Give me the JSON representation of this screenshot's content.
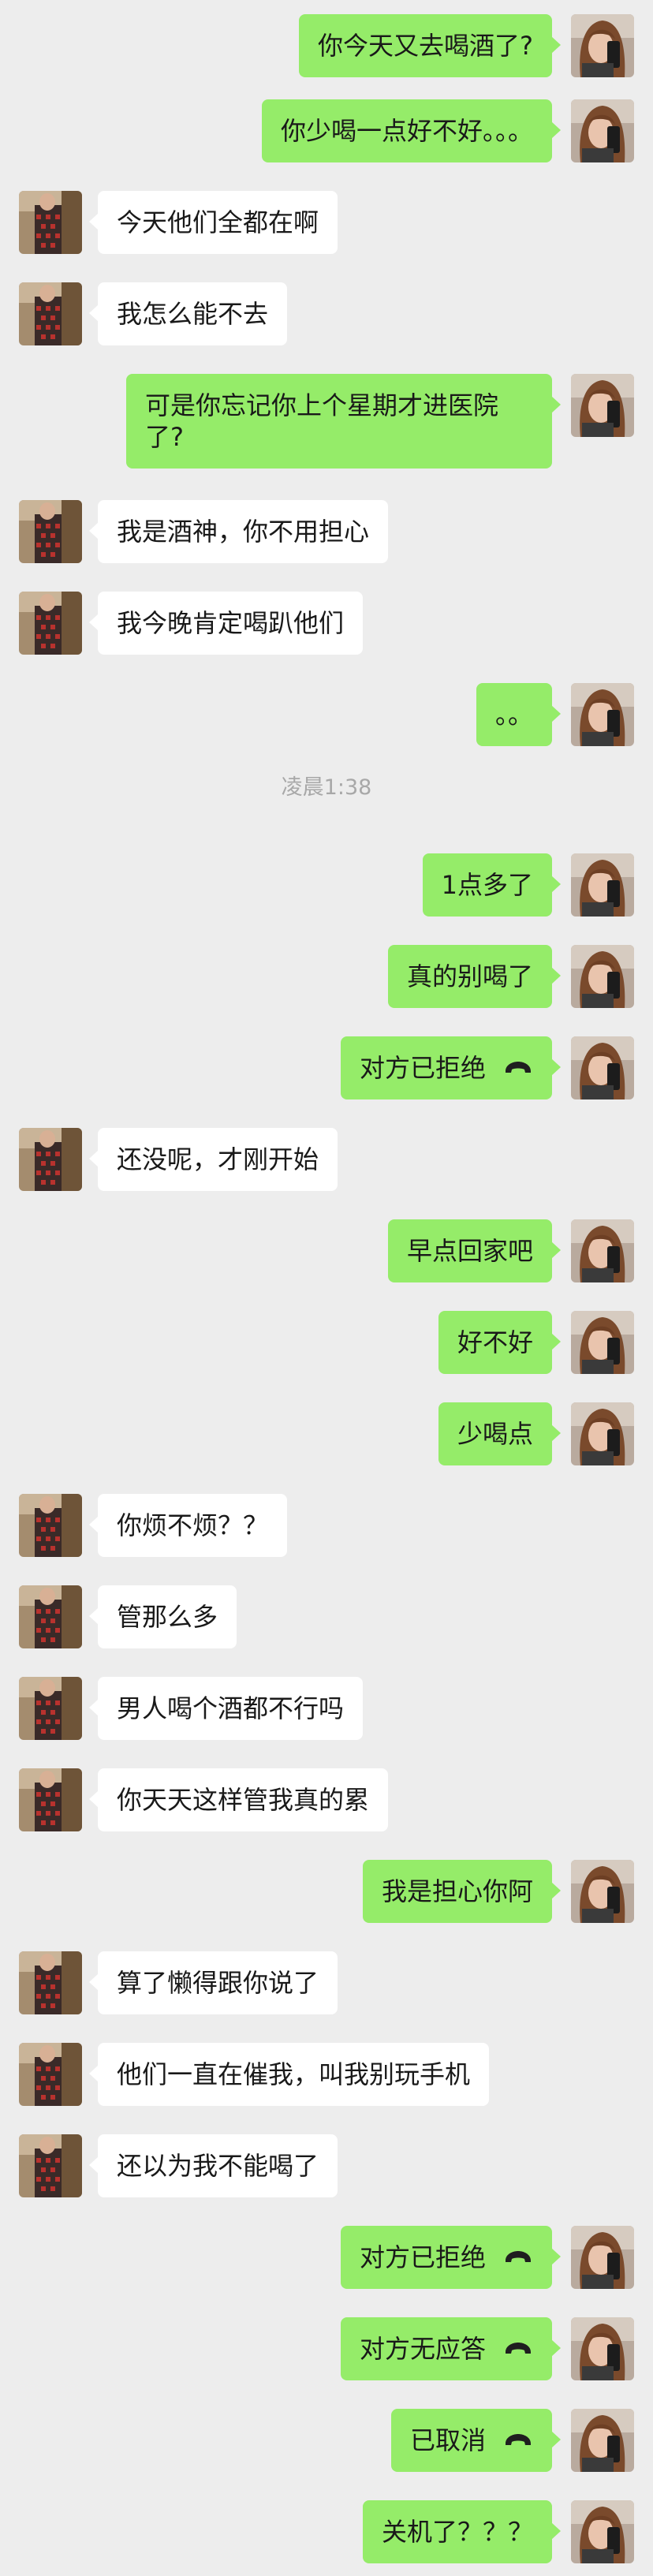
{
  "messages": [
    {
      "side": "out",
      "text": "你今天又去喝酒了?"
    },
    {
      "side": "out",
      "text": "你少喝一点好不好。。。"
    },
    {
      "side": "in",
      "text": "今天他们全都在啊"
    },
    {
      "side": "in",
      "text": "我怎么能不去"
    },
    {
      "side": "out",
      "text": "可是你忘记你上个星期才进医院了?",
      "wrap": true
    },
    {
      "side": "in",
      "text": "我是酒神，你不用担心"
    },
    {
      "side": "in",
      "text": "我今晚肯定喝趴他们"
    },
    {
      "side": "out",
      "text": "。。"
    },
    {
      "type": "timestamp",
      "text": "凌晨1:38"
    },
    {
      "side": "out",
      "text": "1点多了"
    },
    {
      "side": "out",
      "text": "真的别喝了"
    },
    {
      "side": "out",
      "text": "对方已拒绝",
      "call": true
    },
    {
      "side": "in",
      "text": "还没呢，才刚开始"
    },
    {
      "side": "out",
      "text": "早点回家吧"
    },
    {
      "side": "out",
      "text": "好不好"
    },
    {
      "side": "out",
      "text": "少喝点"
    },
    {
      "side": "in",
      "text": "你烦不烦？？"
    },
    {
      "side": "in",
      "text": "管那么多"
    },
    {
      "side": "in",
      "text": "男人喝个酒都不行吗"
    },
    {
      "side": "in",
      "text": "你天天这样管我真的累"
    },
    {
      "side": "out",
      "text": "我是担心你阿"
    },
    {
      "side": "in",
      "text": "算了懒得跟你说了"
    },
    {
      "side": "in",
      "text": "他们一直在催我，叫我别玩手机"
    },
    {
      "side": "in",
      "text": "还以为我不能喝了"
    },
    {
      "side": "out",
      "text": "对方已拒绝",
      "call": true
    },
    {
      "side": "out",
      "text": "对方无应答",
      "call": true
    },
    {
      "side": "out",
      "text": "已取消",
      "call": true
    },
    {
      "side": "out",
      "text": "关机了？？？"
    }
  ],
  "colors": {
    "background": "#ededed",
    "outgoing_bubble": "#95ec69",
    "incoming_bubble": "#ffffff",
    "timestamp_text": "#a8a8a8"
  },
  "icons": {
    "call": "phone-hangup-icon",
    "me_avatar": "avatar-me",
    "contact_avatar": "avatar-contact"
  }
}
